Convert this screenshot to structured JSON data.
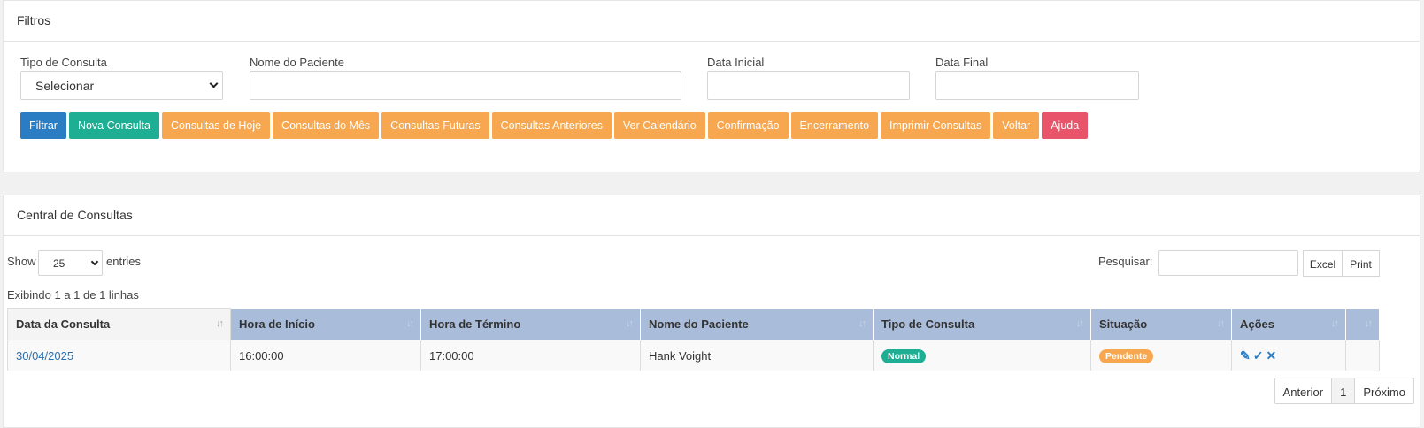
{
  "filters": {
    "title": "Filtros",
    "tipo_label": "Tipo de Consulta",
    "tipo_value": "Selecionar",
    "nome_label": "Nome do Paciente",
    "nome_value": "",
    "data_inicial_label": "Data Inicial",
    "data_inicial_value": "",
    "data_final_label": "Data Final",
    "data_final_value": "",
    "buttons": {
      "filtrar": "Filtrar",
      "nova": "Nova Consulta",
      "hoje": "Consultas de Hoje",
      "mes": "Consultas do Mês",
      "futuras": "Consultas Futuras",
      "anteriores": "Consultas Anteriores",
      "calendario": "Ver Calendário",
      "confirmacao": "Confirmação",
      "encerramento": "Encerramento",
      "imprimir": "Imprimir Consultas",
      "voltar": "Voltar",
      "ajuda": "Ajuda"
    }
  },
  "central": {
    "title": "Central de Consultas",
    "show_label": "Show",
    "entries_value": "25",
    "entries_label": "entries",
    "search_label": "Pesquisar:",
    "search_value": "",
    "excel": "Excel",
    "print": "Print",
    "info": "Exibindo 1 a 1 de 1 linhas",
    "columns": [
      "Data da Consulta",
      "Hora de Início",
      "Hora de Término",
      "Nome do Paciente",
      "Tipo de Consulta",
      "Situação",
      "Ações",
      ""
    ],
    "rows": [
      {
        "data": "30/04/2025",
        "inicio": "16:00:00",
        "termino": "17:00:00",
        "paciente": "Hank Voight",
        "tipo": "Normal",
        "situacao": "Pendente"
      }
    ],
    "pager": {
      "prev": "Anterior",
      "page": "1",
      "next": "Próximo"
    }
  },
  "icons": {
    "edit": "edit-icon",
    "confirm": "check-icon",
    "cancel": "close-icon",
    "sort": "sort-icon"
  },
  "colors": {
    "blue": "#2a7cc3",
    "teal": "#1eae93",
    "orange": "#f7a74f",
    "red": "#e8546a",
    "header": "#a9bddb"
  }
}
